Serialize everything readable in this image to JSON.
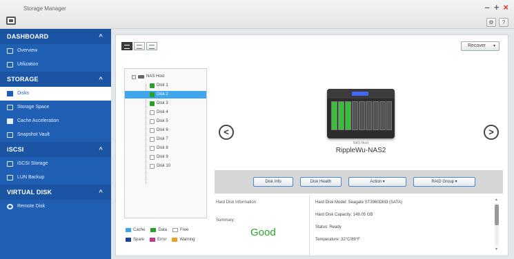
{
  "window": {
    "title": "Storage Manager",
    "controls": {
      "minimize": "–",
      "maximize": "+",
      "close": "×"
    },
    "tools": {
      "settings": "⚙",
      "help": "?"
    }
  },
  "sidebar": {
    "sections": [
      {
        "label": "DASHBOARD",
        "items": [
          {
            "label": "Overview"
          },
          {
            "label": "Utilization"
          }
        ]
      },
      {
        "label": "STORAGE",
        "items": [
          {
            "label": "Disks"
          },
          {
            "label": "Storage Space"
          },
          {
            "label": "Cache Acceleration"
          },
          {
            "label": "Snapshot Vault"
          }
        ]
      },
      {
        "label": "iSCSI",
        "items": [
          {
            "label": "iSCSI Storage"
          },
          {
            "label": "LUN Backup"
          }
        ]
      },
      {
        "label": "VIRTUAL DISK",
        "items": [
          {
            "label": "Remote Disk"
          }
        ]
      }
    ],
    "caret": "^"
  },
  "toolbar": {
    "recover_label": "Recover",
    "recover_arrow": "▾"
  },
  "tree": {
    "root": "NAS Host",
    "expander": "−",
    "disks": [
      "Disk 1",
      "Disk 2",
      "Disk 3",
      "Disk 4",
      "Disk 5",
      "Disk 6",
      "Disk 7",
      "Disk 8",
      "Disk 9",
      "Disk 10"
    ],
    "selected": "Disk 2"
  },
  "legend": {
    "items": [
      {
        "label": "Cache",
        "color": "#3ea6ea"
      },
      {
        "label": "Data",
        "color": "#2aa02a"
      },
      {
        "label": "Free",
        "color": "#ffffff"
      },
      {
        "label": "Spare",
        "color": "#1f3f9a"
      },
      {
        "label": "Error",
        "color": "#c0398f"
      },
      {
        "label": "Warning",
        "color": "#f0a020"
      }
    ]
  },
  "device": {
    "tag": "NAS Host",
    "name": "RippleWu-NAS2",
    "nav_prev": "<",
    "nav_next": ">"
  },
  "actions": {
    "disk_info": "Disk Info",
    "disk_health": "Disk Health",
    "action": "Action ▾",
    "raid_group": "RAID Group ▾"
  },
  "info": {
    "title": "Hard Disk Information",
    "summary_label": "Summary:",
    "summary_value": "Good",
    "model": "Hard Disk Model: Seagate ST3960DM3 (SATA)",
    "capacity": "Hard Disk Capacity: 149.05 GB",
    "status": "Status: Ready",
    "temperature": "Temperature: 32°C/89°F",
    "scroll_up": "▲",
    "scroll_down": "▼"
  },
  "colors": {
    "accent": "#1f5fb4",
    "selection": "#3ea6ea",
    "good": "#2aa02a",
    "close": "#d9302c"
  }
}
